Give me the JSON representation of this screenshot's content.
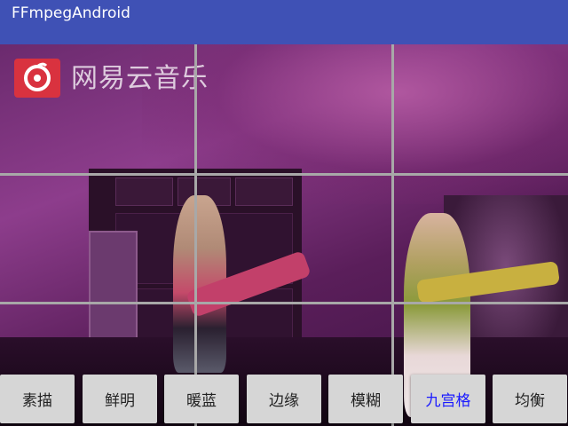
{
  "app": {
    "title": "FFmpegAndroid"
  },
  "video": {
    "watermark_text": "网易云音乐",
    "watermark_logo": "netease-music-logo"
  },
  "filters": [
    {
      "label": "素描",
      "active": false
    },
    {
      "label": "鲜明",
      "active": false
    },
    {
      "label": "暖蓝",
      "active": false
    },
    {
      "label": "边缘",
      "active": false
    },
    {
      "label": "模糊",
      "active": false
    },
    {
      "label": "九宫格",
      "active": true
    },
    {
      "label": "均衡",
      "active": false
    }
  ],
  "colors": {
    "appbar": "#3f51b5",
    "button_bg": "#d6d6d6",
    "button_text": "#222222",
    "button_active_text": "#1a1aff",
    "grid_line": "#a8a8a8"
  }
}
